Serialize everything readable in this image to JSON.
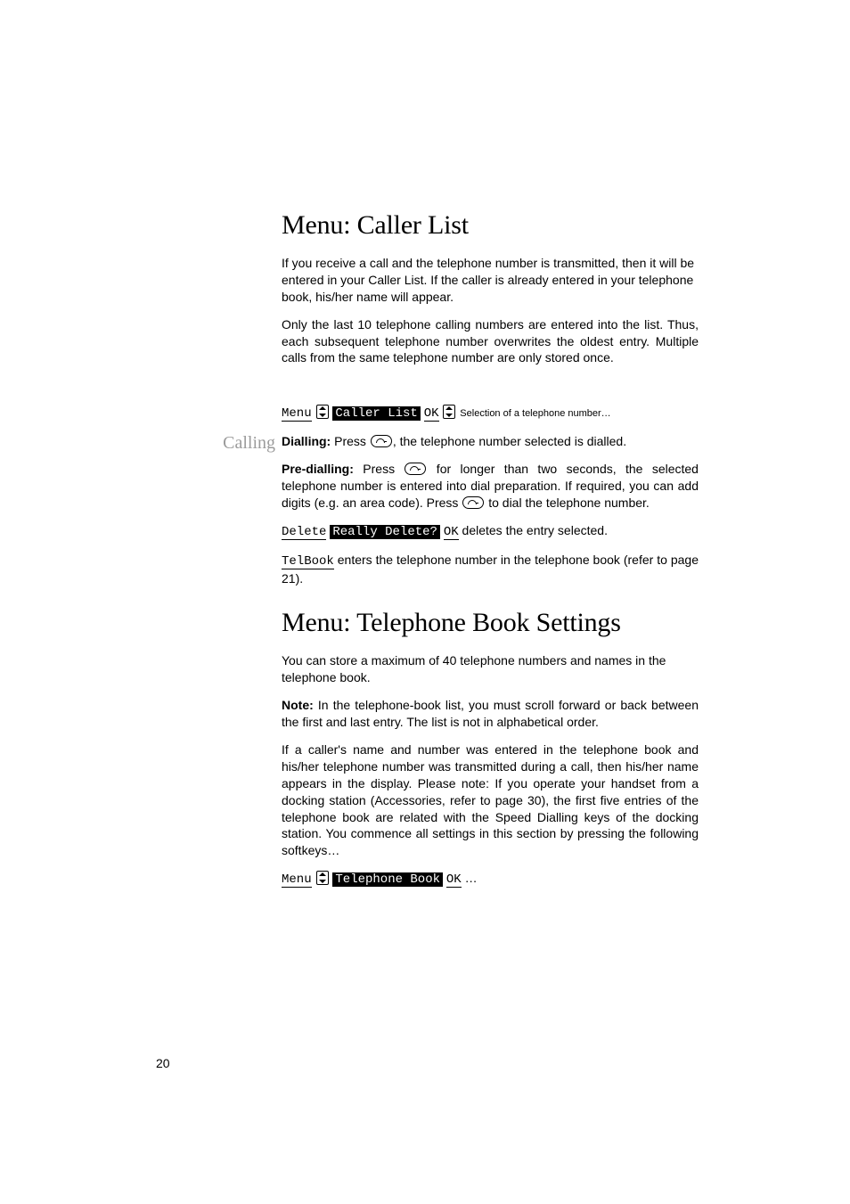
{
  "page_number": "20",
  "section1": {
    "heading": "Menu: Caller List",
    "para1": "If you receive a call and the telephone number is transmitted, then it will be entered in your Caller List. If the caller is already entered in your telephone book, his/her name will appear.",
    "para2": "Only the last 10 telephone calling numbers are entered into the list. Thus, each subsequent telephone number overwrites the oldest entry. Multiple calls from the same telephone number are only stored once."
  },
  "calling": {
    "sideword": "Calling",
    "seq": {
      "menu": "Menu",
      "caller_list": "Caller List",
      "ok": "OK",
      "trail": "Selection of a telephone number…"
    },
    "dialling_label": "Dialling:",
    "dialling_pre": " Press ",
    "dialling_post": ", the telephone number selected is dialled.",
    "predial_label": "Pre-dialling:",
    "predial_pre": " Press ",
    "predial_mid": " for longer than two seconds, the selected telephone number is entered into dial preparation. If required, you can add digits (e.g. an area code). Press ",
    "predial_post": " to dial the telephone number.",
    "delete": "Delete",
    "really_delete": "Really Delete?",
    "delete_ok": "OK",
    "delete_tail": " deletes the entry selected.",
    "telbook": "TelBook",
    "telbook_tail": " enters the telephone number in the telephone book (refer to page 21)."
  },
  "section2": {
    "heading": "Menu: Telephone Book Settings",
    "para1": "You can store a maximum of 40 telephone numbers and names in the telephone book.",
    "note_label": "Note:",
    "note_body": " In the telephone-book list, you must scroll forward or back between the first and last entry. The list is not in alphabetical order.",
    "para3": "If a caller's name and number was entered in the telephone book and his/her telephone number was transmitted during a call, then his/her name appears in the display. Please note: If you operate your handset from a docking station (Accessories, refer to page 30), the first five entries of the telephone book are related with the Speed Dialling keys of the docking station. You commence all settings in this section by pressing the following softkeys…",
    "seq": {
      "menu": "Menu",
      "telephone_book": "Telephone Book",
      "ok": "OK",
      "trail": "…"
    }
  }
}
